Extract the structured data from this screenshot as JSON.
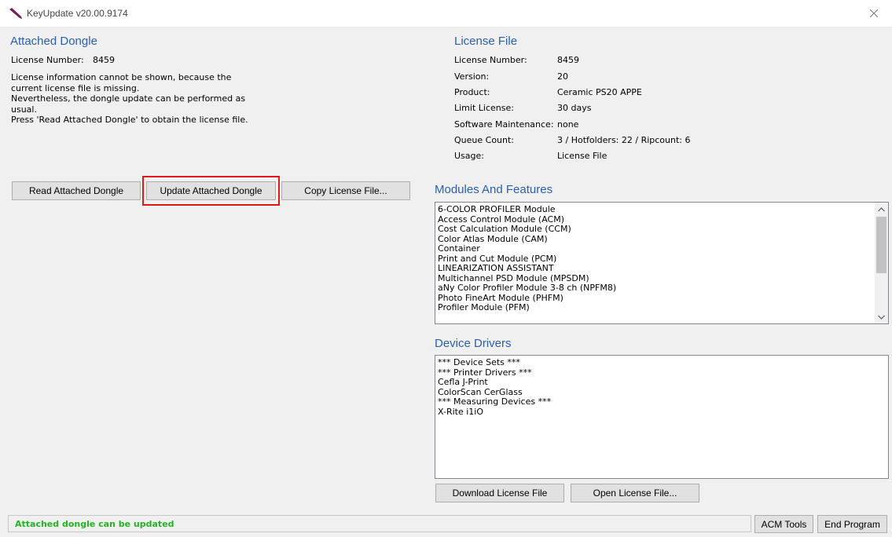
{
  "window": {
    "title": "KeyUpdate v20.00.9174"
  },
  "attached_dongle": {
    "heading": "Attached Dongle",
    "license_number_label": "License Number:",
    "license_number_value": "8459",
    "message_lines": [
      "License information cannot be shown, because the",
      "current license file is missing.",
      "Nevertheless, the dongle update can be performed as",
      "usual.",
      "Press 'Read Attached Dongle' to obtain the license file."
    ]
  },
  "license_file": {
    "heading": "License File",
    "rows": [
      {
        "label": "License Number:",
        "value": "8459"
      },
      {
        "label": "Version:",
        "value": "20"
      },
      {
        "label": "Product:",
        "value": "Ceramic PS20 APPE"
      },
      {
        "label": "Limit License:",
        "value": "30 days"
      },
      {
        "label": "Software Maintenance:",
        "value": "none"
      },
      {
        "label": "Queue Count:",
        "value": "3 / Hotfolders: 22 / Ripcount: 6"
      },
      {
        "label": "Usage:",
        "value": "License File"
      }
    ]
  },
  "buttons": {
    "read": "Read Attached Dongle",
    "update": "Update Attached Dongle",
    "copy": "Copy License File...",
    "download": "Download License File",
    "open": "Open License File...",
    "acm_tools": "ACM Tools",
    "end_program": "End Program"
  },
  "modules": {
    "heading": "Modules And Features",
    "items": [
      "6-COLOR PROFILER Module",
      "Access Control Module (ACM)",
      "Cost Calculation Module (CCM)",
      "Color Atlas Module (CAM)",
      "Container",
      "Print and Cut Module (PCM)",
      "LINEARIZATION ASSISTANT",
      "Multichannel PSD Module (MPSDM)",
      "aNy Color Profiler Module 3-8 ch (NPFM8)",
      "Photo FineArt Module (PHFM)",
      "Profiler Module (PFM)"
    ]
  },
  "drivers": {
    "heading": "Device Drivers",
    "items": [
      "*** Device Sets ***",
      "*** Printer Drivers ***",
      "Cefla J-Print",
      "ColorScan CerGlass",
      "*** Measuring Devices ***",
      "X-Rite i1iO"
    ]
  },
  "status": {
    "text": "Attached dongle can be updated",
    "color": "#22b422"
  },
  "colors": {
    "heading": "#2b5fad",
    "highlight_border": "#e2161e"
  }
}
